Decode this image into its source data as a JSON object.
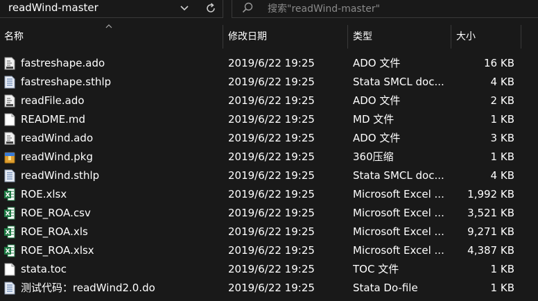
{
  "toolbar": {
    "path": "readWind-master",
    "search_placeholder": "搜索\"readWind-master\""
  },
  "columns": {
    "name": "名称",
    "date": "修改日期",
    "type": "类型",
    "size": "大小"
  },
  "files": [
    {
      "name": "fastreshape.ado",
      "date": "2019/6/22 19:25",
      "type": "ADO 文件",
      "size": "16 KB",
      "icon": "ado-file-icon"
    },
    {
      "name": "fastreshape.sthlp",
      "date": "2019/6/22 19:25",
      "type": "Stata SMCL doc...",
      "size": "4 KB",
      "icon": "stata-doc-icon"
    },
    {
      "name": "readFile.ado",
      "date": "2019/6/22 19:25",
      "type": "ADO 文件",
      "size": "2 KB",
      "icon": "ado-file-icon"
    },
    {
      "name": "README.md",
      "date": "2019/6/22 19:25",
      "type": "MD 文件",
      "size": "1 KB",
      "icon": "blank-file-icon"
    },
    {
      "name": "readWind.ado",
      "date": "2019/6/22 19:25",
      "type": "ADO 文件",
      "size": "3 KB",
      "icon": "ado-file-icon"
    },
    {
      "name": "readWind.pkg",
      "date": "2019/6/22 19:25",
      "type": "360压缩",
      "size": "1 KB",
      "icon": "archive-icon"
    },
    {
      "name": "readWind.sthlp",
      "date": "2019/6/22 19:25",
      "type": "Stata SMCL doc...",
      "size": "4 KB",
      "icon": "stata-doc-icon"
    },
    {
      "name": "ROE.xlsx",
      "date": "2019/6/22 19:25",
      "type": "Microsoft Excel ...",
      "size": "1,992 KB",
      "icon": "excel-icon"
    },
    {
      "name": "ROE_ROA.csv",
      "date": "2019/6/22 19:25",
      "type": "Microsoft Excel ...",
      "size": "3,521 KB",
      "icon": "excel-icon"
    },
    {
      "name": "ROE_ROA.xls",
      "date": "2019/6/22 19:25",
      "type": "Microsoft Excel ...",
      "size": "9,271 KB",
      "icon": "excel-icon"
    },
    {
      "name": "ROE_ROA.xlsx",
      "date": "2019/6/22 19:25",
      "type": "Microsoft Excel ...",
      "size": "4,387 KB",
      "icon": "excel-icon"
    },
    {
      "name": "stata.toc",
      "date": "2019/6/22 19:25",
      "type": "TOC 文件",
      "size": "1 KB",
      "icon": "blank-file-icon"
    },
    {
      "name": "测试代码：readWind2.0.do",
      "date": "2019/6/22 19:25",
      "type": "Stata Do-file",
      "size": "1 KB",
      "icon": "stata-doc-icon"
    }
  ],
  "colors": {
    "background": "#191919",
    "border": "#3a3a3a",
    "excel_green": "#1e7a44"
  }
}
